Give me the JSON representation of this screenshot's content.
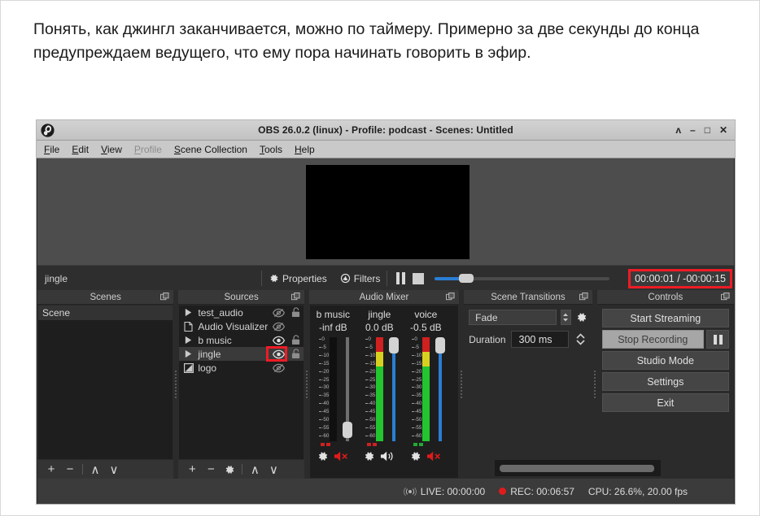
{
  "article": {
    "paragraph": "Понять, как джингл заканчивается, можно по таймеру. Примерно за две секунды до конца предупреждаем ведущего, что ему пора начинать говорить в эфир."
  },
  "window": {
    "title": "OBS 26.0.2 (linux) - Profile: podcast - Scenes: Untitled",
    "buttons": {
      "rollup": "ʌ",
      "minimize": "–",
      "maximize": "□",
      "close": "✕"
    }
  },
  "menu": {
    "items": [
      {
        "label": "File",
        "disabled": false
      },
      {
        "label": "Edit",
        "disabled": false
      },
      {
        "label": "View",
        "disabled": false
      },
      {
        "label": "Profile",
        "disabled": true
      },
      {
        "label": "Scene Collection",
        "disabled": false
      },
      {
        "label": "Tools",
        "disabled": false
      },
      {
        "label": "Help",
        "disabled": false
      }
    ]
  },
  "media_bar": {
    "source_name": "jingle",
    "properties_label": "Properties",
    "filters_label": "Filters",
    "timer": "00:00:01 / -00:00:15",
    "highlight_color": "#ee1c25",
    "progress_percent": 14
  },
  "scenes": {
    "title": "Scenes",
    "items": [
      {
        "label": "Scene",
        "selected": true
      }
    ],
    "toolbar": [
      "+",
      "−",
      "∧",
      "∨"
    ]
  },
  "sources": {
    "title": "Sources",
    "items": [
      {
        "label": "test_audio",
        "icon": "media-play-icon",
        "visible": false,
        "locked": false
      },
      {
        "label": "Audio Visualizer",
        "icon": "document-icon",
        "visible": false,
        "locked": false,
        "no_lock": true
      },
      {
        "label": "b music",
        "icon": "media-play-icon",
        "visible": true,
        "locked": false
      },
      {
        "label": "jingle",
        "icon": "media-play-icon",
        "visible": true,
        "locked": false,
        "selected": true,
        "highlighted": true
      },
      {
        "label": "logo",
        "icon": "image-icon",
        "visible": false,
        "locked": false,
        "no_lock": true
      }
    ],
    "toolbar": [
      "+",
      "−",
      "gear-icon",
      "∧",
      "∨"
    ]
  },
  "audio_mixer": {
    "title": "Audio Mixer",
    "channels": [
      {
        "name": "b music",
        "db": "-inf dB",
        "muted": true,
        "fader_percent": 4,
        "level_percent": 0,
        "peak_color": "#cc2222"
      },
      {
        "name": "jingle",
        "db": "0.0 dB",
        "muted": false,
        "fader_percent": 100,
        "level_percent": 100,
        "peak_color": "#cc2222"
      },
      {
        "name": "voice",
        "db": "-0.5 dB",
        "muted": true,
        "fader_percent": 100,
        "level_percent": 100,
        "peak_color": "#22aa33"
      }
    ],
    "scale_ticks": [
      "0",
      "-5",
      "-10",
      "-15",
      "-20",
      "-25",
      "-30",
      "-35",
      "-40",
      "-45",
      "-50",
      "-55",
      "-60"
    ]
  },
  "scene_transitions": {
    "title": "Scene Transitions",
    "transition": "Fade",
    "duration_label": "Duration",
    "duration_value": "300 ms"
  },
  "controls": {
    "title": "Controls",
    "start_streaming": "Start Streaming",
    "stop_recording": "Stop Recording",
    "studio_mode": "Studio Mode",
    "settings": "Settings",
    "exit": "Exit"
  },
  "status_bar": {
    "live": "LIVE: 00:00:00",
    "rec": "REC: 00:06:57",
    "cpu": "CPU: 26.6%, 20.00 fps"
  }
}
